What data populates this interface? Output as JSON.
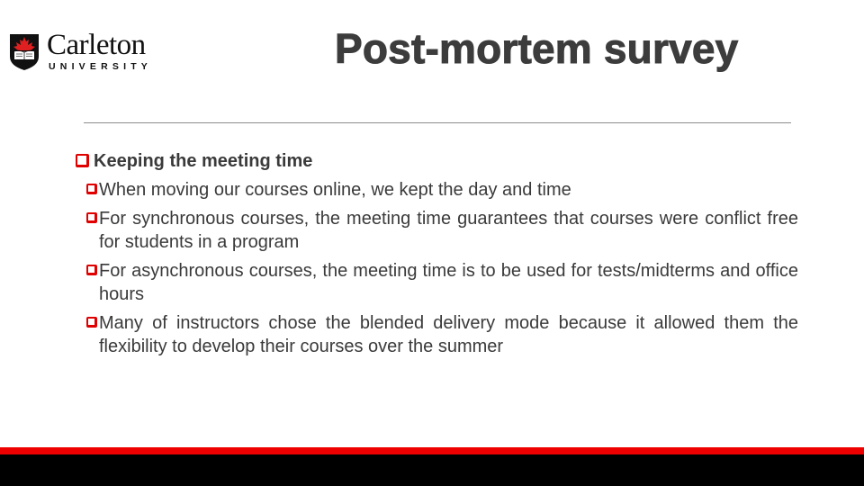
{
  "logo": {
    "name": "Carleton",
    "subtitle": "UNIVERSITY",
    "icon": "maple-leaf-shield-icon"
  },
  "title": "Post-mortem survey",
  "bullets": [
    {
      "level": 1,
      "text": "Keeping the meeting time",
      "icon": "checkbox-bullet-icon"
    },
    {
      "level": 2,
      "text": "When moving our courses online, we kept the day and time",
      "icon": "checkbox-bullet-icon"
    },
    {
      "level": 2,
      "text": "For synchronous courses, the meeting time guarantees that courses were conflict free for students in a program",
      "icon": "checkbox-bullet-icon"
    },
    {
      "level": 2,
      "text": "For asynchronous courses, the meeting time is to be used for tests/midterms and office hours",
      "icon": "checkbox-bullet-icon"
    },
    {
      "level": 2,
      "text": "Many of instructors chose the blended delivery mode because it allowed them the flexibility to develop their courses over the summer",
      "icon": "checkbox-bullet-icon"
    }
  ],
  "colors": {
    "accent_red": "#ee0000",
    "footer_black": "#000000",
    "text": "#3a3a3a"
  }
}
